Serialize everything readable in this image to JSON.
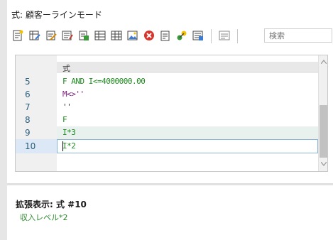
{
  "window": {
    "title": "式: 顧客ーラインモード"
  },
  "toolbar": {
    "search_placeholder": "検索"
  },
  "editor": {
    "header_label": "式",
    "rows": [
      {
        "line": "5",
        "code": "F AND I<=4000000.00",
        "color": "#1d8a1d"
      },
      {
        "line": "6",
        "code": "M<>''",
        "color": "#7a1f7a"
      },
      {
        "line": "7",
        "code": "''",
        "color": "#333333"
      },
      {
        "line": "8",
        "code": "F",
        "color": "#1d8a1d"
      },
      {
        "line": "9",
        "code": "I*3",
        "color": "#1d8a1d"
      },
      {
        "line": "10",
        "code": "I*2",
        "color": "#1d8a1d"
      }
    ]
  },
  "expanded": {
    "title": "拡張表示: 式 #10",
    "value": "収入レベル*2"
  }
}
